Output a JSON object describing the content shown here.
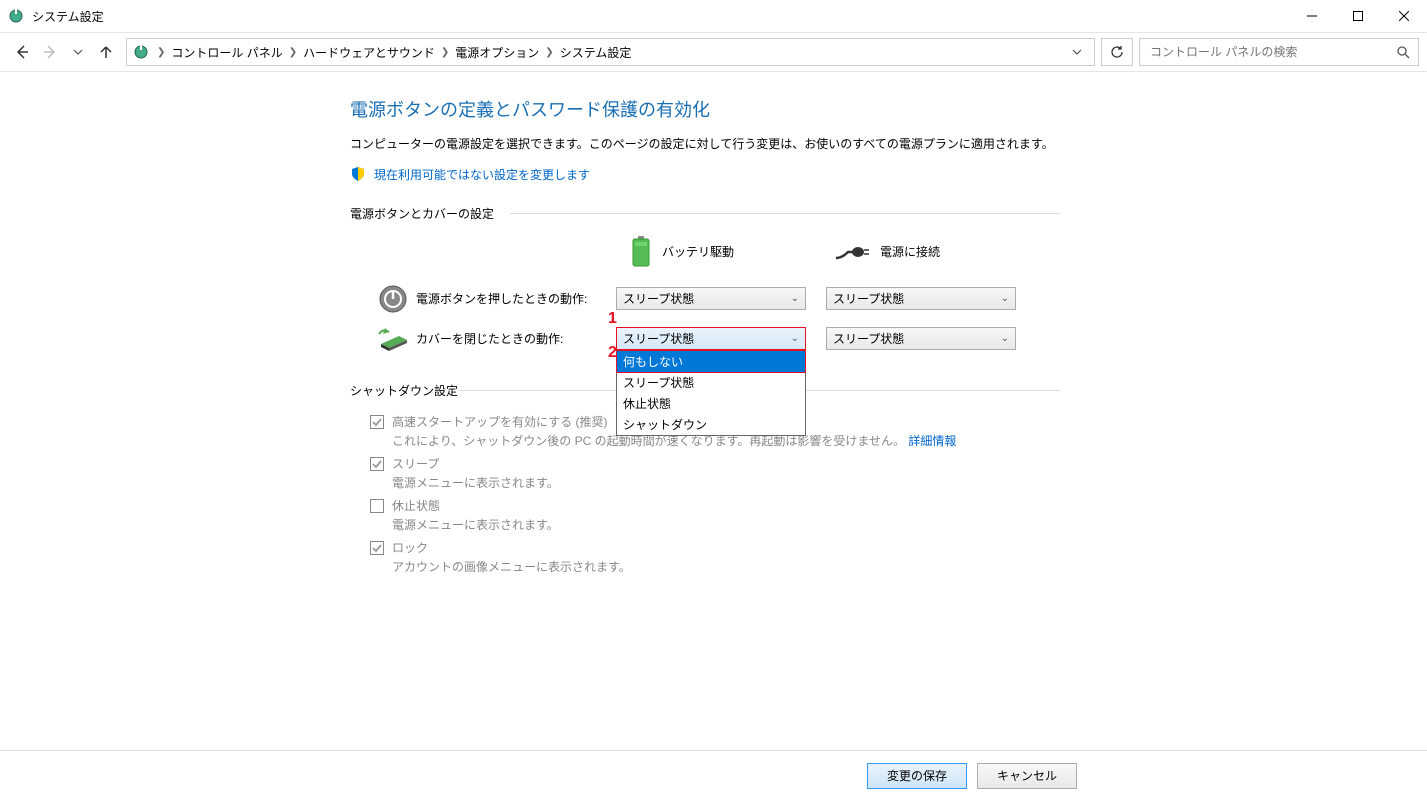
{
  "window": {
    "title": "システム設定"
  },
  "breadcrumb": {
    "items": [
      "コントロール パネル",
      "ハードウェアとサウンド",
      "電源オプション",
      "システム設定"
    ]
  },
  "search": {
    "placeholder": "コントロール パネルの検索"
  },
  "main": {
    "heading": "電源ボタンの定義とパスワード保護の有効化",
    "description": "コンピューターの電源設定を選択できます。このページの設定に対して行う変更は、お使いのすべての電源プランに適用されます。",
    "admin_link": "現在利用可能ではない設定を変更します"
  },
  "section1": {
    "title": "電源ボタンとカバーの設定",
    "col_battery": "バッテリ駆動",
    "col_plugged": "電源に接続",
    "rows": [
      {
        "label": "電源ボタンを押したときの動作:",
        "battery_val": "スリープ状態",
        "plugged_val": "スリープ状態"
      },
      {
        "label": "カバーを閉じたときの動作:",
        "battery_val": "スリープ状態",
        "plugged_val": "スリープ状態"
      }
    ],
    "dropdown_options": [
      "何もしない",
      "スリープ状態",
      "休止状態",
      "シャットダウン"
    ]
  },
  "section2": {
    "title": "シャットダウン設定",
    "items": [
      {
        "title": "高速スタートアップを有効にする (推奨)",
        "desc_pre": "これにより、シャットダウン後の PC の起動時間が速くなります。再起動は影響を受けません。",
        "link": "詳細情報",
        "checked": true,
        "disabled": true
      },
      {
        "title": "スリープ",
        "desc": "電源メニューに表示されます。",
        "checked": true,
        "disabled": true
      },
      {
        "title": "休止状態",
        "desc": "電源メニューに表示されます。",
        "checked": false,
        "disabled": true
      },
      {
        "title": "ロック",
        "desc": "アカウントの画像メニューに表示されます。",
        "checked": true,
        "disabled": true
      }
    ]
  },
  "footer": {
    "save": "変更の保存",
    "cancel": "キャンセル"
  },
  "annotations": {
    "a1": "1",
    "a2": "2"
  }
}
